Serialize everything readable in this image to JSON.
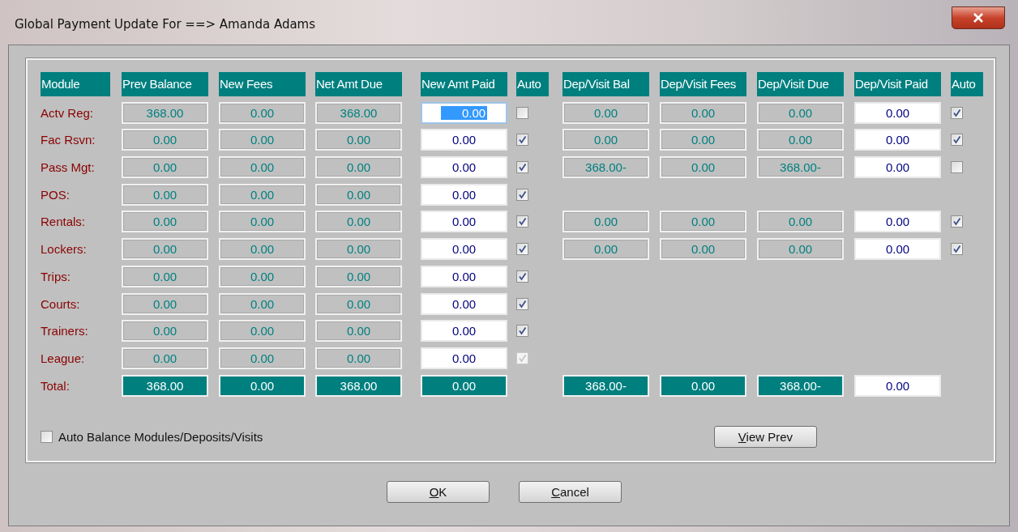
{
  "window": {
    "title": "Global Payment Update For ==> Amanda Adams"
  },
  "columns": [
    "Module",
    "Prev Balance",
    "New Fees",
    "Net Amt Due",
    "New Amt Paid",
    "Auto",
    "Dep/Visit Bal",
    "Dep/Visit Fees",
    "Dep/Visit Due",
    "Dep/Visit Paid",
    "Auto"
  ],
  "rows": [
    {
      "module": "Actv Reg:",
      "prev_balance": "368.00",
      "new_fees": "0.00",
      "net_amt_due": "368.00",
      "new_amt_paid": "0.00",
      "paid_focused": true,
      "auto": false,
      "auto_disabled": false,
      "deposit": {
        "bal": "0.00",
        "fees": "0.00",
        "due": "0.00",
        "paid": "0.00",
        "auto": true
      }
    },
    {
      "module": "Fac Rsvn:",
      "prev_balance": "0.00",
      "new_fees": "0.00",
      "net_amt_due": "0.00",
      "new_amt_paid": "0.00",
      "paid_focused": false,
      "auto": true,
      "auto_disabled": false,
      "deposit": {
        "bal": "0.00",
        "fees": "0.00",
        "due": "0.00",
        "paid": "0.00",
        "auto": true
      }
    },
    {
      "module": "Pass Mgt:",
      "prev_balance": "0.00",
      "new_fees": "0.00",
      "net_amt_due": "0.00",
      "new_amt_paid": "0.00",
      "paid_focused": false,
      "auto": true,
      "auto_disabled": false,
      "deposit": {
        "bal": "368.00-",
        "fees": "0.00",
        "due": "368.00-",
        "paid": "0.00",
        "auto": false
      }
    },
    {
      "module": "POS:",
      "prev_balance": "0.00",
      "new_fees": "0.00",
      "net_amt_due": "0.00",
      "new_amt_paid": "0.00",
      "paid_focused": false,
      "auto": true,
      "auto_disabled": false
    },
    {
      "module": "Rentals:",
      "prev_balance": "0.00",
      "new_fees": "0.00",
      "net_amt_due": "0.00",
      "new_amt_paid": "0.00",
      "paid_focused": false,
      "auto": true,
      "auto_disabled": false,
      "deposit": {
        "bal": "0.00",
        "fees": "0.00",
        "due": "0.00",
        "paid": "0.00",
        "auto": true
      }
    },
    {
      "module": "Lockers:",
      "prev_balance": "0.00",
      "new_fees": "0.00",
      "net_amt_due": "0.00",
      "new_amt_paid": "0.00",
      "paid_focused": false,
      "auto": true,
      "auto_disabled": false,
      "deposit": {
        "bal": "0.00",
        "fees": "0.00",
        "due": "0.00",
        "paid": "0.00",
        "auto": true
      }
    },
    {
      "module": "Trips:",
      "prev_balance": "0.00",
      "new_fees": "0.00",
      "net_amt_due": "0.00",
      "new_amt_paid": "0.00",
      "paid_focused": false,
      "auto": true,
      "auto_disabled": false
    },
    {
      "module": "Courts:",
      "prev_balance": "0.00",
      "new_fees": "0.00",
      "net_amt_due": "0.00",
      "new_amt_paid": "0.00",
      "paid_focused": false,
      "auto": true,
      "auto_disabled": false
    },
    {
      "module": "Trainers:",
      "prev_balance": "0.00",
      "new_fees": "0.00",
      "net_amt_due": "0.00",
      "new_amt_paid": "0.00",
      "paid_focused": false,
      "auto": true,
      "auto_disabled": false
    },
    {
      "module": "League:",
      "prev_balance": "0.00",
      "new_fees": "0.00",
      "net_amt_due": "0.00",
      "new_amt_paid": "0.00",
      "paid_focused": false,
      "auto": true,
      "auto_disabled": true
    }
  ],
  "total": {
    "label": "Total:",
    "prev_balance": "368.00",
    "new_fees": "0.00",
    "net_amt_due": "368.00",
    "new_amt_paid": "0.00",
    "dep_bal": "368.00-",
    "dep_fees": "0.00",
    "dep_due": "368.00-",
    "dep_paid": "0.00"
  },
  "auto_balance": {
    "label": "Auto Balance Modules/Deposits/Visits",
    "checked": false
  },
  "view_prev_button": "View Prev",
  "buttons": [
    "OK",
    "Cancel"
  ]
}
